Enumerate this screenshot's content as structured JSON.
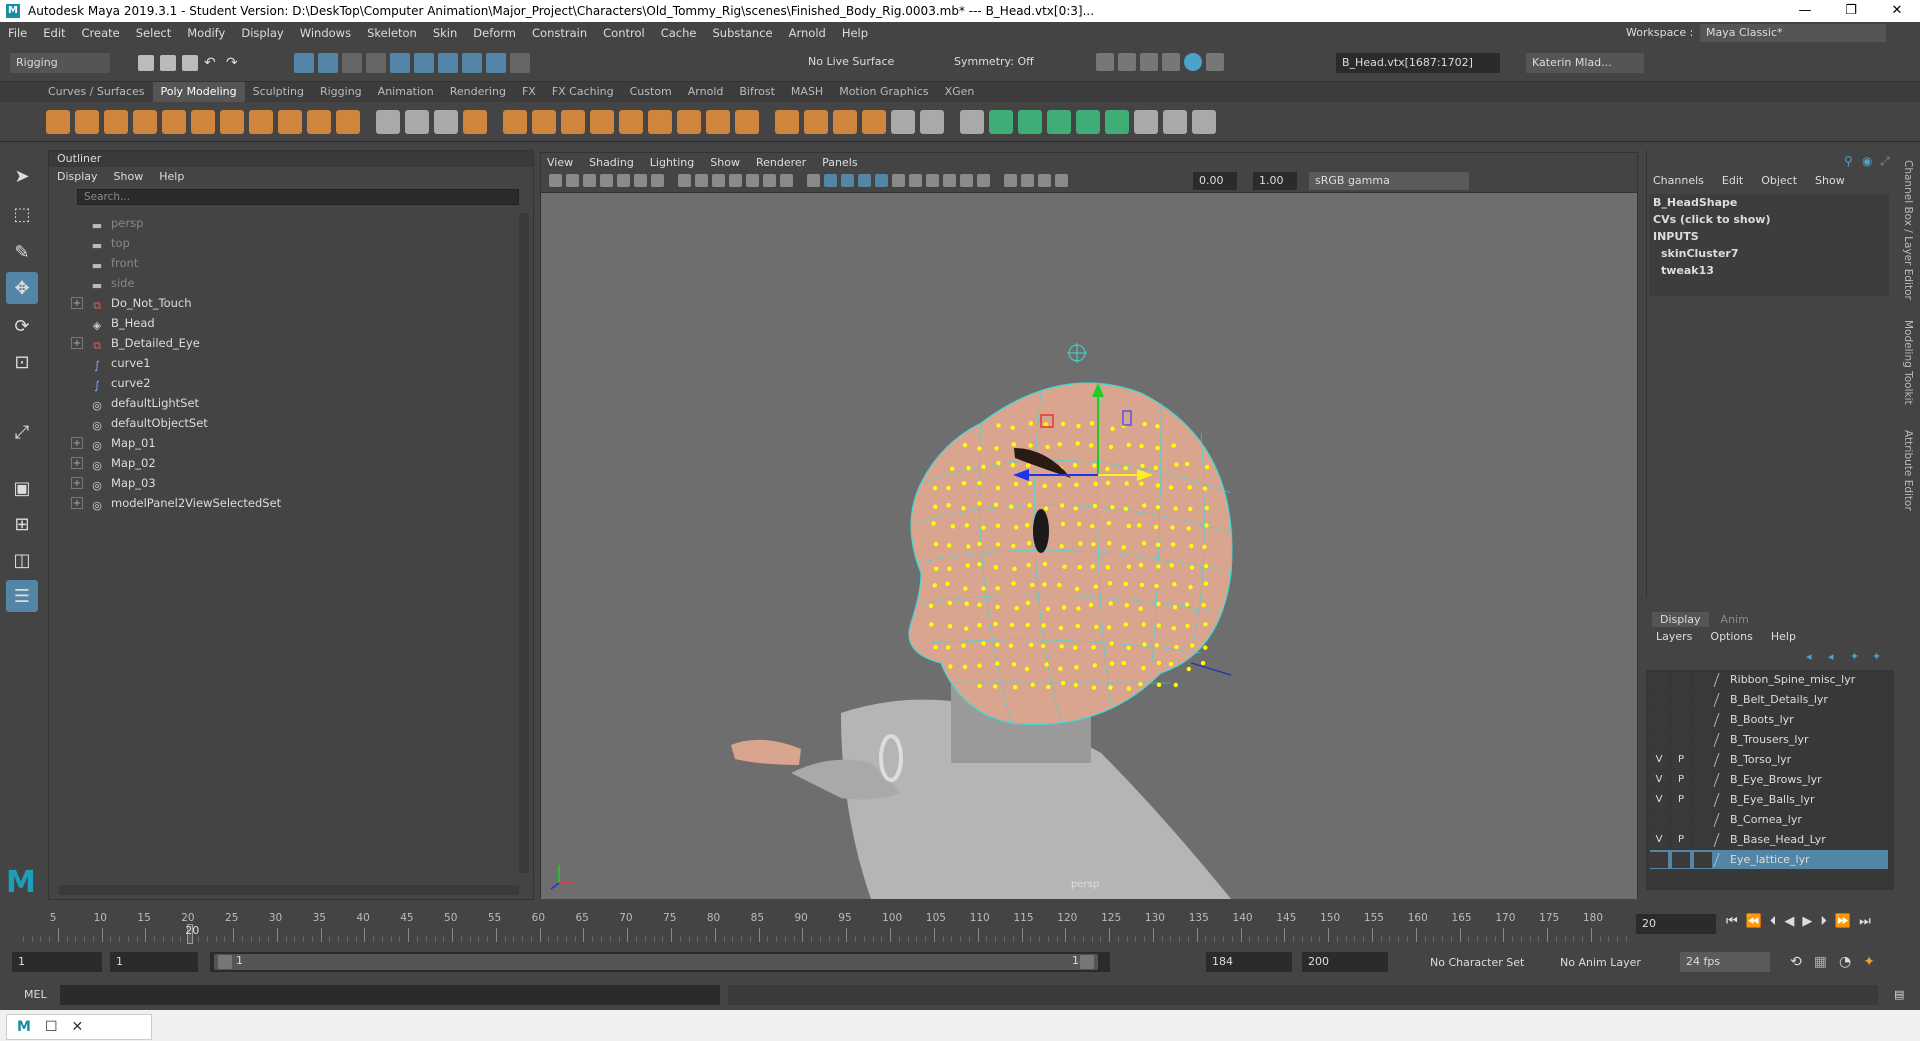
{
  "window": {
    "title": "Autodesk Maya 2019.3.1 - Student Version: D:\\DeskTop\\Computer Animation\\Major_Project\\Characters\\Old_Tommy_Rig\\scenes\\Finished_Body_Rig.0003.mb*   ---   B_Head.vtx[0:3]...",
    "minimize": "—",
    "maximize": "❐",
    "close": "✕"
  },
  "menubar": [
    "File",
    "Edit",
    "Create",
    "Select",
    "Modify",
    "Display",
    "Windows",
    "Skeleton",
    "Skin",
    "Deform",
    "Constrain",
    "Control",
    "Cache",
    "Substance",
    "Arnold",
    "Help"
  ],
  "workspace": {
    "label": "Workspace :",
    "value": "Maya Classic*"
  },
  "status": {
    "menuset": "Rigging",
    "live_surface": "No Live Surface",
    "symmetry": "Symmetry: Off",
    "selection_field": "B_Head.vtx[1687:1702]",
    "user": "Katerin Mlad..."
  },
  "shelf_tabs": [
    "Curves / Surfaces",
    "Poly Modeling",
    "Sculpting",
    "Rigging",
    "Animation",
    "Rendering",
    "FX",
    "FX Caching",
    "Custom",
    "Arnold",
    "Bifrost",
    "MASH",
    "Motion Graphics",
    "XGen"
  ],
  "shelf_active": "Poly Modeling",
  "outliner": {
    "title": "Outliner",
    "menus": [
      "Display",
      "Show",
      "Help"
    ],
    "search_placeholder": "Search...",
    "items": [
      {
        "label": "persp",
        "icon": "camera-icon",
        "expandable": false,
        "dim": true
      },
      {
        "label": "top",
        "icon": "camera-icon",
        "expandable": false,
        "dim": true
      },
      {
        "label": "front",
        "icon": "camera-icon",
        "expandable": false,
        "dim": true
      },
      {
        "label": "side",
        "icon": "camera-icon",
        "expandable": false,
        "dim": true
      },
      {
        "label": "Do_Not_Touch",
        "icon": "group-icon",
        "expandable": true,
        "dim": false
      },
      {
        "label": "B_Head",
        "icon": "mesh-icon",
        "expandable": false,
        "dim": false
      },
      {
        "label": "B_Detailed_Eye",
        "icon": "group-icon",
        "expandable": true,
        "dim": false
      },
      {
        "label": "curve1",
        "icon": "curve-icon",
        "expandable": false,
        "dim": false
      },
      {
        "label": "curve2",
        "icon": "curve-icon",
        "expandable": false,
        "dim": false
      },
      {
        "label": "defaultLightSet",
        "icon": "set-icon",
        "expandable": false,
        "dim": false
      },
      {
        "label": "defaultObjectSet",
        "icon": "set-icon",
        "expandable": false,
        "dim": false
      },
      {
        "label": "Map_01",
        "icon": "set-icon",
        "expandable": true,
        "dim": false
      },
      {
        "label": "Map_02",
        "icon": "set-icon",
        "expandable": true,
        "dim": false
      },
      {
        "label": "Map_03",
        "icon": "set-icon",
        "expandable": true,
        "dim": false
      },
      {
        "label": "modelPanel2ViewSelectedSet",
        "icon": "set-icon",
        "expandable": true,
        "dim": false
      }
    ]
  },
  "viewport": {
    "menus": [
      "View",
      "Shading",
      "Lighting",
      "Show",
      "Renderer",
      "Panels"
    ],
    "exposure": "0.00",
    "gamma": "1.00",
    "color_space": "sRGB gamma",
    "camera_label": "persp"
  },
  "channelbox": {
    "menus": [
      "Channels",
      "Edit",
      "Object",
      "Show"
    ],
    "shape": "B_HeadShape",
    "cvs": "CVs (click to show)",
    "inputs_label": "INPUTS",
    "inputs": [
      "skinCluster7",
      "tweak13"
    ]
  },
  "layers": {
    "tabs": [
      "Display",
      "Anim"
    ],
    "menus": [
      "Layers",
      "Options",
      "Help"
    ],
    "rows": [
      {
        "name": "Ribbon_Spine_misc_lyr",
        "v": "",
        "p": "",
        "selected": false
      },
      {
        "name": "B_Belt_Details_lyr",
        "v": "",
        "p": "",
        "selected": false
      },
      {
        "name": "B_Boots_lyr",
        "v": "",
        "p": "",
        "selected": false
      },
      {
        "name": "B_Trousers_lyr",
        "v": "",
        "p": "",
        "selected": false
      },
      {
        "name": "B_Torso_lyr",
        "v": "V",
        "p": "P",
        "selected": false
      },
      {
        "name": "B_Eye_Brows_lyr",
        "v": "V",
        "p": "P",
        "selected": false
      },
      {
        "name": "B_Eye_Balls_lyr",
        "v": "V",
        "p": "P",
        "selected": false
      },
      {
        "name": "B_Cornea_lyr",
        "v": "",
        "p": "",
        "selected": false
      },
      {
        "name": "B_Base_Head_Lyr",
        "v": "V",
        "p": "P",
        "selected": false
      },
      {
        "name": "Eye_lattice_lyr",
        "v": "",
        "p": "",
        "selected": true
      }
    ]
  },
  "right_strip": [
    "Channel Box / Layer Editor",
    "Modeling Toolkit",
    "Attribute Editor"
  ],
  "timeline": {
    "ticks": [
      "5",
      "10",
      "15",
      "20",
      "25",
      "30",
      "35",
      "40",
      "45",
      "50",
      "55",
      "60",
      "65",
      "70",
      "75",
      "80",
      "85",
      "90",
      "95",
      "100",
      "105",
      "110",
      "115",
      "120",
      "125",
      "130",
      "135",
      "140",
      "145",
      "150",
      "155",
      "160",
      "165",
      "170",
      "175",
      "180"
    ],
    "current_frame_marker": "20",
    "current_frame_field": "20"
  },
  "range": {
    "start": "1",
    "anim_start": "1",
    "slider_start": "1",
    "slider_end": "184",
    "anim_end": "184",
    "end": "200",
    "character_set": "No Character Set",
    "anim_layer": "No Anim Layer",
    "fps": "24 fps"
  },
  "mel": {
    "label": "MEL"
  },
  "colors": {
    "accent": "#5285a6",
    "wire": "#3fd8d8",
    "vertex": "#ffff00",
    "skin": "#d9a58f"
  }
}
